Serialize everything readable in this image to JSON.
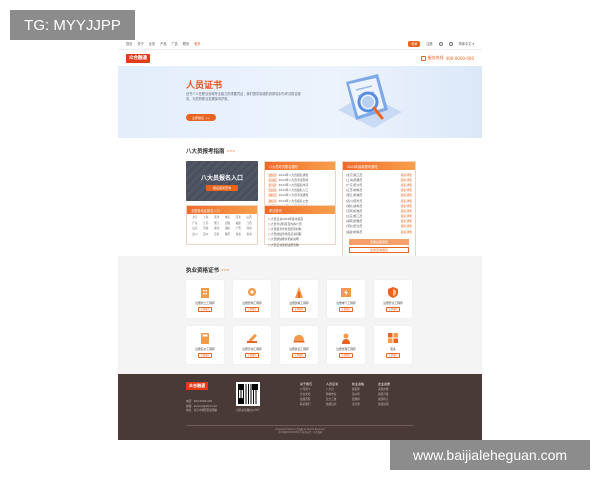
{
  "watermark": {
    "top_left": "TG: MYYJJPP",
    "bottom_right": "www.baijialeheguan.com"
  },
  "topnav": {
    "links": [
      "首页",
      "关于",
      "业务",
      "产品",
      "广告",
      "联系",
      "更多"
    ],
    "active_index": 6,
    "right_pill": "登录",
    "right_text": "注册",
    "lang": "简体中文"
  },
  "header": {
    "logo": "众合融通",
    "hotline_label": "服务热线",
    "hotline_number": "400-0000-000"
  },
  "hero": {
    "title": "人员证书",
    "desc": "证书个人在职业领域专业能力的重要凭证，我们提供权威的资质培训与考试报名服务，为您的职业发展保驾护航。",
    "cta": "立即报名 >>"
  },
  "guide": {
    "title": "八大员报考指南",
    "more": ">>>",
    "entry_title": "八大员报名入口",
    "entry_button": "报名报考查询",
    "panel1": {
      "title": "八大员考试报名通知",
      "items": [
        {
          "tag": "[北京]",
          "text": "2024年八大员报名通知"
        },
        {
          "tag": "[上海]",
          "text": "2024年八大员考试安排"
        },
        {
          "tag": "[广东]",
          "text": "2024年八大员报名时间"
        },
        {
          "tag": "[江苏]",
          "text": "2024年八大员报名入口"
        },
        {
          "tag": "[浙江]",
          "text": "2024年八大员考试通知"
        },
        {
          "tag": "[四川]",
          "text": "2024年八大员报名公告"
        },
        {
          "tag": "[湖北]",
          "text": "2024年八大员报考条件"
        }
      ]
    },
    "panel2": {
      "title": "2024年最新报考通知",
      "items": [
        {
          "text": "[北京]施工员",
          "right": "报名通知"
        },
        {
          "text": "[上海]质量员",
          "right": "报名通知"
        },
        {
          "text": "[广东]安全员",
          "right": "报名通知"
        },
        {
          "text": "[江苏]材料员",
          "right": "报名通知"
        },
        {
          "text": "[浙江]机械员",
          "right": "报名通知"
        },
        {
          "text": "[四川]劳务员",
          "right": "报名通知"
        },
        {
          "text": "[湖北]资料员",
          "right": "报名通知"
        },
        {
          "text": "[河南]标准员",
          "right": "报名通知"
        },
        {
          "text": "[山东]施工员",
          "right": "报名通知"
        },
        {
          "text": "[湖南]质量员",
          "right": "报名通知"
        },
        {
          "text": "[河北]安全员",
          "right": "报名通知"
        },
        {
          "text": "[福建]材料员",
          "right": "报名通知"
        }
      ],
      "foot_primary": "查看全部通知",
      "foot_secondary": "在线咨询报名"
    },
    "panel3": {
      "title": "全国各地区报名入口",
      "regions": [
        "北京",
        "上海",
        "天津",
        "重庆",
        "河北",
        "山西",
        "广东",
        "江苏",
        "浙江",
        "安徽",
        "福建",
        "江西",
        "山东",
        "河南",
        "湖北",
        "湖南",
        "广西",
        "海南",
        "四川",
        "贵州",
        "云南",
        "陕西",
        "甘肃",
        "青海"
      ]
    },
    "panel4": {
      "title": "考试资讯",
      "items": [
        {
          "text": "八大员证书2024年报考指南"
        },
        {
          "text": "八大员考试科目及内容介绍"
        },
        {
          "text": "八大员报考条件及所需材料"
        },
        {
          "text": "八大员成绩查询及证书领取"
        },
        {
          "text": "八大员继续教育相关说明"
        },
        {
          "text": "八大员证书延期注册流程"
        }
      ]
    }
  },
  "certs": {
    "title": "执业资格证书",
    "more": ">>>",
    "cards": [
      {
        "name": "注册岩土工程师",
        "btn": "立即报名",
        "icon": "building-icon"
      },
      {
        "name": "注册结构工程师",
        "btn": "立即报名",
        "icon": "gear-structure-icon"
      },
      {
        "name": "注册建筑工程师",
        "btn": "立即报名",
        "icon": "tower-icon"
      },
      {
        "name": "注册电气工程师",
        "btn": "立即报名",
        "icon": "electric-icon"
      },
      {
        "name": "注册安全工程师",
        "btn": "立即报名",
        "icon": "shield-icon"
      },
      {
        "name": "注册造价工程师",
        "btn": "立即报名",
        "icon": "calculator-icon"
      },
      {
        "name": "注册咨询工程师",
        "btn": "立即报名",
        "icon": "pencil-ruler-icon"
      },
      {
        "name": "注册建造工程师",
        "btn": "立即报名",
        "icon": "helmet-icon"
      },
      {
        "name": "注册监理工程师",
        "btn": "立即报名",
        "icon": "worker-icon"
      },
      {
        "name": "更多",
        "btn": "立即报名",
        "icon": "grid-icon"
      }
    ]
  },
  "footer": {
    "logo": "众合融通",
    "info": [
      "电话：400-0000-000",
      "邮箱：service@zhrt.com",
      "地址：北京市朝阳区建国路"
    ],
    "qr_caption": "扫码关注微信公众号",
    "columns": [
      {
        "head": "关于我们",
        "items": [
          "公司简介",
          "企业文化",
          "发展历程",
          "联系我们"
        ]
      },
      {
        "head": "人员证书",
        "items": [
          "八大员",
          "特种作业",
          "安全三类",
          "技能证书"
        ]
      },
      {
        "head": "执业资格",
        "items": [
          "建造师",
          "造价师",
          "监理师",
          "安全师"
        ]
      },
      {
        "head": "企业资质",
        "items": [
          "资质办理",
          "资质升级",
          "资质转让",
          "资质延期"
        ]
      }
    ],
    "copyright": "Copyright©2024 众合融通 All Rights Reserved",
    "icp": "京ICP备00000000号-1   技术支持：众合融通"
  },
  "colors": {
    "accent": "#e86420",
    "footer_bg": "#4a3a37",
    "hero_bg": "#e3eefb"
  }
}
